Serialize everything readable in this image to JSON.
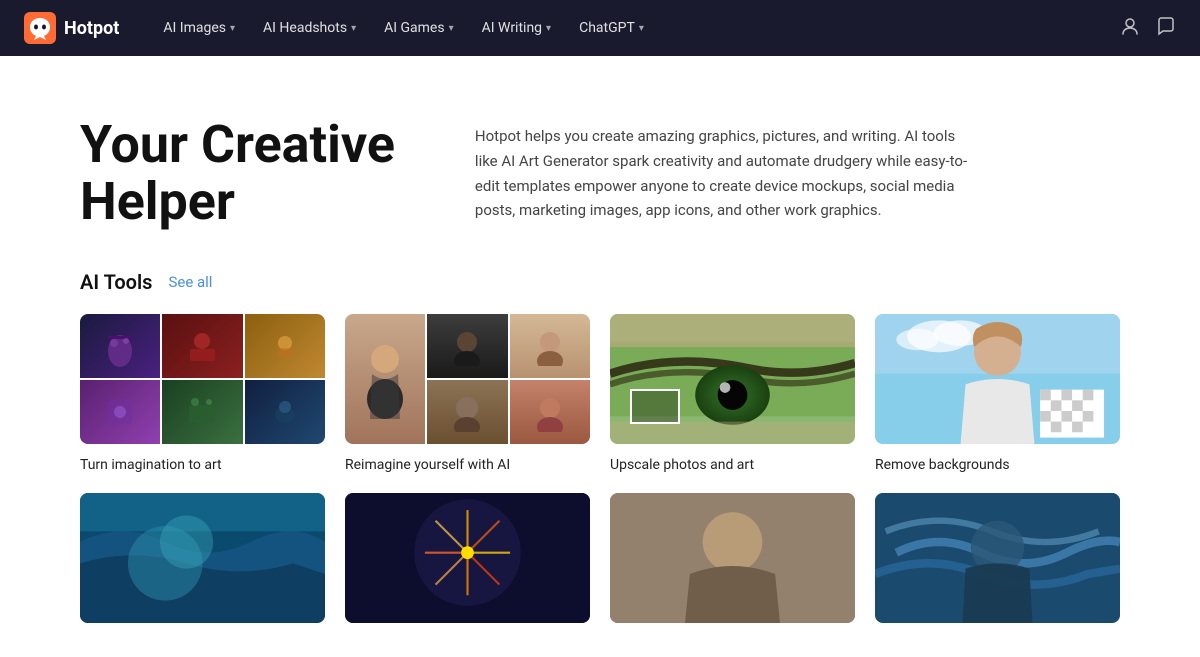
{
  "nav": {
    "brand": "Hotpot",
    "items": [
      {
        "label": "AI Images",
        "id": "ai-images"
      },
      {
        "label": "AI Headshots",
        "id": "ai-headshots"
      },
      {
        "label": "AI Games",
        "id": "ai-games"
      },
      {
        "label": "AI Writing",
        "id": "ai-writing"
      },
      {
        "label": "ChatGPT",
        "id": "chatgpt"
      }
    ]
  },
  "hero": {
    "title_line1": "Your Creative",
    "title_line2": "Helper",
    "description": "Hotpot helps you create amazing graphics, pictures, and writing. AI tools like AI Art Generator spark creativity and automate drudgery while easy-to-edit templates empower anyone to create device mockups, social media posts, marketing images, app icons, and other work graphics."
  },
  "tools_section": {
    "title": "AI Tools",
    "see_all": "See all",
    "tools": [
      {
        "label": "Turn imagination to art",
        "id": "art-generator"
      },
      {
        "label": "Reimagine yourself with AI",
        "id": "headshots"
      },
      {
        "label": "Upscale photos and art",
        "id": "upscale"
      },
      {
        "label": "Remove backgrounds",
        "id": "remove-bg"
      }
    ],
    "second_row": [
      {
        "label": "",
        "id": "ocean"
      },
      {
        "label": "",
        "id": "fireworks"
      },
      {
        "label": "",
        "id": "portrait"
      },
      {
        "label": "",
        "id": "painting"
      }
    ]
  }
}
